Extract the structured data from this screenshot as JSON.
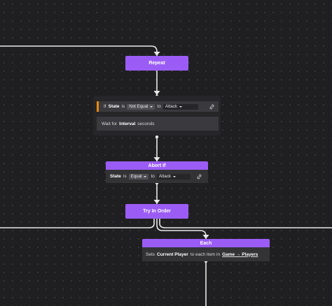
{
  "nodes": {
    "repeat": {
      "label": "Repeat"
    },
    "if_block": {
      "if_word": "If",
      "variable": "State",
      "is_word": "is",
      "operator": "Not Equal",
      "to_word": "to",
      "value": "Attack",
      "wait_prefix": "Wait for",
      "wait_variable": "Interval",
      "wait_suffix": "seconds"
    },
    "abort_if": {
      "label": "Abort If",
      "variable": "State",
      "is_word": "is",
      "operator": "Equal",
      "to_word": "to",
      "value": "Attack"
    },
    "try_in_order": {
      "label": "Try In Order"
    },
    "each": {
      "label": "Each",
      "sets_word": "Sets",
      "variable": "Current Player",
      "middle_text": "to each item in",
      "collection": "Game → Players"
    }
  },
  "colors": {
    "background": "#1f1f21",
    "node_purple": "#9b5cf6",
    "wire": "#e6e6e6",
    "condition_accent": "#e8890c"
  },
  "icons": {
    "link": "link-icon",
    "dropdown": "chevron-down-icon"
  }
}
